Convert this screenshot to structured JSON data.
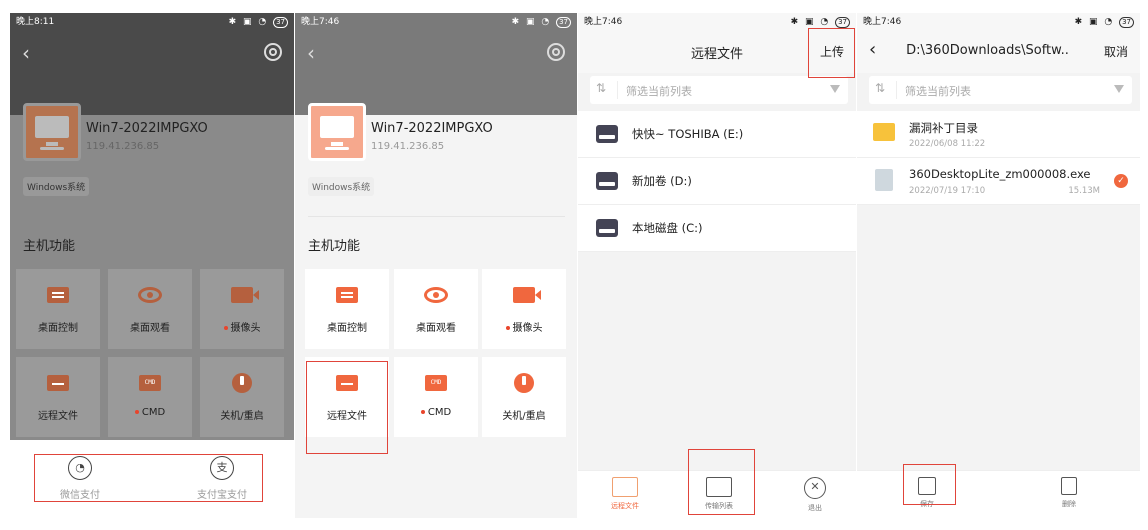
{
  "status_bars": {
    "p1_time": "晚上8:11",
    "p2_time": "晚上7:46",
    "p3_time": "晚上7:46",
    "p4_time": "晚上7:46",
    "battery": "37"
  },
  "host": {
    "name": "Win7-2022IMPGXO",
    "ip": "119.41.236.85",
    "os_tag": "Windows系统",
    "section_title": "主机功能"
  },
  "functions": [
    {
      "label": "桌面控制",
      "icon": "desktop-control-icon"
    },
    {
      "label": "桌面观看",
      "icon": "eye-icon"
    },
    {
      "label": "摄像头",
      "icon": "camera-icon"
    },
    {
      "label": "远程文件",
      "icon": "folder-icon"
    },
    {
      "label": "CMD",
      "icon": "cmd-icon"
    },
    {
      "label": "关机/重启",
      "icon": "power-icon"
    }
  ],
  "functions_icon_text": {
    "cmd": "CMD"
  },
  "payment": {
    "wechat": "微信支付",
    "alipay": "支付宝支付",
    "alipay_glyph": "支"
  },
  "remote_files": {
    "title": "远程文件",
    "upload": "上传",
    "filter_placeholder": "筛选当前列表",
    "drives": [
      {
        "name": "快快~   TOSHIBA (E:)"
      },
      {
        "name": "新加卷 (D:)"
      },
      {
        "name": "本地磁盘 (C:)"
      }
    ],
    "tabs": [
      {
        "label": "远程文件"
      },
      {
        "label": "传输列表"
      },
      {
        "label": "退出"
      }
    ]
  },
  "browser": {
    "path": "D:\\360Downloads\\Softw..",
    "cancel": "取消",
    "filter_placeholder": "筛选当前列表",
    "files": [
      {
        "name": "漏洞补丁目录",
        "date": "2022/06/08 11:22",
        "size": "",
        "type": "folder"
      },
      {
        "name": "360DesktopLite_zm000008.exe",
        "date": "2022/07/19 17:10",
        "size": "15.13M",
        "type": "file",
        "selected": true
      }
    ],
    "actions": [
      {
        "label": "保存"
      },
      {
        "label": "删除"
      }
    ]
  }
}
